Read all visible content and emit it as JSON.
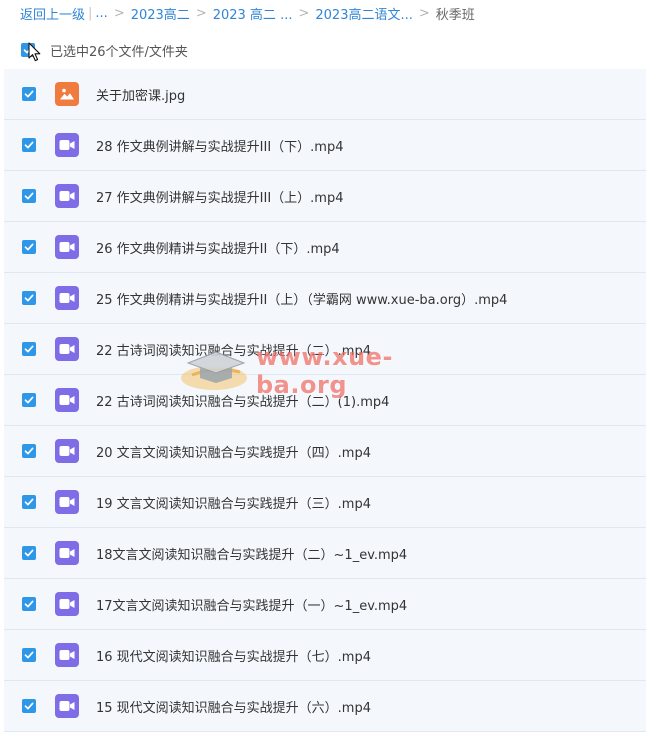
{
  "breadcrumb": {
    "back": "返回上一级",
    "pipe": "|",
    "ellipsis": "...",
    "items": [
      "2023高二",
      "2023 高二 ...",
      "2023高二语文..."
    ],
    "current": "秋季班"
  },
  "selection": {
    "text": "已选中26个文件/文件夹",
    "checked": true
  },
  "files": [
    {
      "name": "关于加密课.jpg",
      "type": "image"
    },
    {
      "name": "28 作文典例讲解与实战提升III（下）.mp4",
      "type": "video"
    },
    {
      "name": "27 作文典例讲解与实战提升III（上）.mp4",
      "type": "video"
    },
    {
      "name": "26 作文典例精讲与实战提升II（下）.mp4",
      "type": "video"
    },
    {
      "name": "25 作文典例精讲与实战提升II（上）（学霸网 www.xue-ba.org）.mp4",
      "type": "video"
    },
    {
      "name": "22 古诗词阅读知识融合与实战提升（二）.mp4",
      "type": "video"
    },
    {
      "name": "22 古诗词阅读知识融合与实战提升（二）(1).mp4",
      "type": "video"
    },
    {
      "name": "20 文言文阅读知识融合与实践提升（四）.mp4",
      "type": "video"
    },
    {
      "name": "19 文言文阅读知识融合与实践提升（三）.mp4",
      "type": "video"
    },
    {
      "name": "18文言文阅读知识融合与实践提升（二）~1_ev.mp4",
      "type": "video"
    },
    {
      "name": "17文言文阅读知识融合与实践提升（一）~1_ev.mp4",
      "type": "video"
    },
    {
      "name": "16 现代文阅读知识融合与实战提升（七）.mp4",
      "type": "video"
    },
    {
      "name": "15 现代文阅读知识融合与实战提升（六）.mp4",
      "type": "video"
    }
  ],
  "watermark": {
    "text": "www.xue-ba.org"
  },
  "colors": {
    "accent": "#2f97e8",
    "link": "#2f86d6",
    "video": "#7e6de7",
    "image": "#f07b3f",
    "row_bg": "#f4f8fd"
  }
}
